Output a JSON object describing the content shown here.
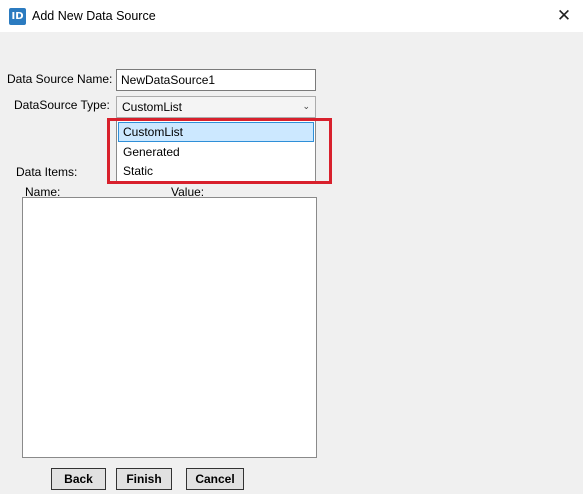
{
  "window": {
    "app_icon_text": "ID",
    "title": "Add New Data Source",
    "close_glyph": "✕"
  },
  "form": {
    "name_label": "Data Source Name:",
    "name_value": "NewDataSource1",
    "type_label": "DataSource Type:",
    "type_value": "CustomList",
    "type_arrow_glyph": "⌄",
    "type_options": [
      "CustomList",
      "Generated",
      "Static"
    ],
    "selected_option": "CustomList"
  },
  "data_items": {
    "label": "Data Items:",
    "columns": [
      "Name:",
      "Value:"
    ],
    "rows": []
  },
  "buttons": {
    "back": "Back",
    "finish": "Finish",
    "cancel": "Cancel"
  },
  "annotation": {
    "highlight_color": "#d8202c"
  },
  "colors": {
    "accent": "#2b7bc0",
    "selected_bg": "#cce8ff",
    "selected_border": "#2f8fd8",
    "client_bg": "#f0f0f0"
  }
}
